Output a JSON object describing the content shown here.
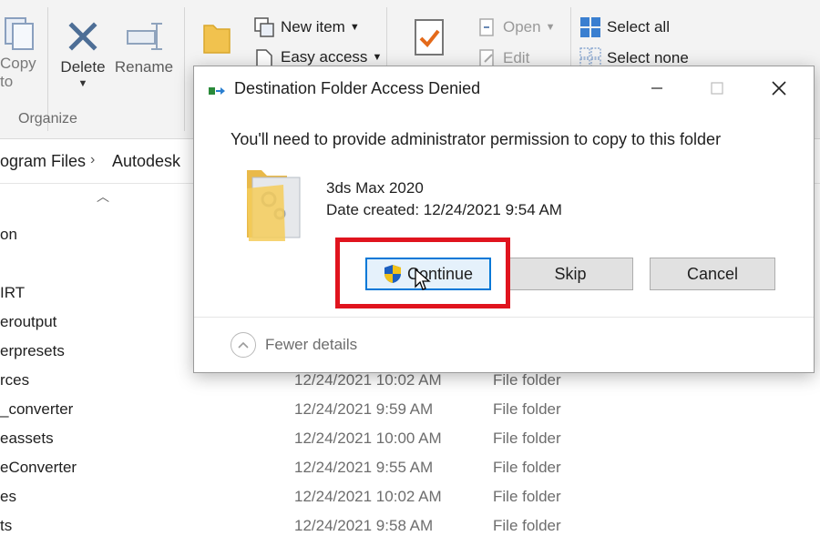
{
  "ribbon": {
    "copy_to": {
      "label": "Copy",
      "sub": "to"
    },
    "delete": {
      "label": "Delete"
    },
    "rename": {
      "label": "Rename"
    },
    "organize_group": "Organize",
    "new_item": "New item",
    "easy_access": "Easy access",
    "open": "Open",
    "edit": "Edit",
    "select_all": "Select all",
    "select_none": "Select none"
  },
  "address_bar": {
    "crumbs": [
      "ogram Files",
      "Autodesk"
    ]
  },
  "file_list": {
    "rows": [
      {
        "name": "on",
        "date": "",
        "type": ""
      },
      {
        "name": "",
        "date": "",
        "type": ""
      },
      {
        "name": "IRT",
        "date": "",
        "type": ""
      },
      {
        "name": "eroutput",
        "date": "",
        "type": ""
      },
      {
        "name": "erpresets",
        "date": "",
        "type": ""
      },
      {
        "name": "rces",
        "date": "12/24/2021 10:02 AM",
        "type": "File folder"
      },
      {
        "name": "_converter",
        "date": "12/24/2021 9:59 AM",
        "type": "File folder"
      },
      {
        "name": "eassets",
        "date": "12/24/2021 10:00 AM",
        "type": "File folder"
      },
      {
        "name": "eConverter",
        "date": "12/24/2021 9:55 AM",
        "type": "File folder"
      },
      {
        "name": "es",
        "date": "12/24/2021 10:02 AM",
        "type": "File folder"
      },
      {
        "name": "ts",
        "date": "12/24/2021 9:58 AM",
        "type": "File folder"
      }
    ]
  },
  "dialog": {
    "title": "Destination Folder Access Denied",
    "message": "You'll need to provide administrator permission to copy to this folder",
    "item_name": "3ds Max 2020",
    "item_date": "Date created: 12/24/2021 9:54 AM",
    "buttons": {
      "continue": "Continue",
      "skip": "Skip",
      "cancel": "Cancel"
    },
    "fewer_details": "Fewer details"
  },
  "colors": {
    "highlight": "#e0141e",
    "primary_border": "#0078d7"
  }
}
